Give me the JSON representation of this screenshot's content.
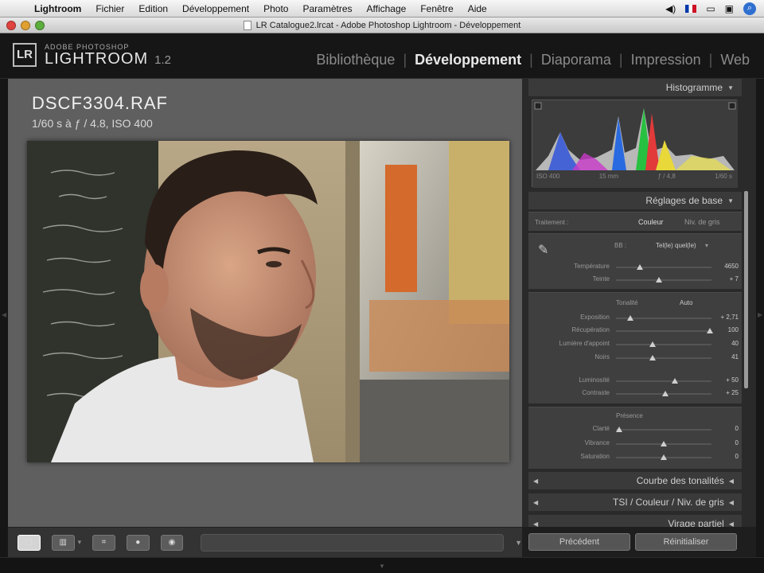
{
  "menubar": {
    "app_name": "Lightroom",
    "items": [
      "Fichier",
      "Edition",
      "Développement",
      "Photo",
      "Paramètres",
      "Affichage",
      "Fenêtre",
      "Aide"
    ]
  },
  "window": {
    "title": "LR Catalogue2.lrcat - Adobe Photoshop Lightroom - Développement"
  },
  "logo": {
    "line1": "ADOBE PHOTOSHOP",
    "line2": "LIGHTROOM",
    "version": "1.2",
    "badge": "LR"
  },
  "modules": [
    {
      "label": "Bibliothèque",
      "active": false
    },
    {
      "label": "Développement",
      "active": true
    },
    {
      "label": "Diaporama",
      "active": false
    },
    {
      "label": "Impression",
      "active": false
    },
    {
      "label": "Web",
      "active": false
    }
  ],
  "photo": {
    "filename": "DSCF3304.RAF",
    "exposure_info": "1/60 s à ƒ / 4.8, ISO 400"
  },
  "histogram": {
    "header": "Histogramme",
    "info": [
      "ISO 400",
      "15 mm",
      "ƒ / 4,8",
      "1/60 s"
    ]
  },
  "basic": {
    "header": "Réglages de base",
    "treatment_label": "Traitement :",
    "treatment_color": "Couleur",
    "treatment_gray": "Niv. de gris",
    "wb_label": "BB :",
    "wb_value": "Tel(le) quel(le)",
    "tone_title": "Tonalité",
    "tone_auto": "Auto",
    "presence_title": "Présence",
    "sliders": [
      {
        "label": "Température",
        "value": "4650",
        "level": 0.25
      },
      {
        "label": "Teinte",
        "value": "+ 7",
        "level": 0.45
      },
      {
        "label": "Exposition",
        "value": "+ 2,71",
        "level": 0.15
      },
      {
        "label": "Récupération",
        "value": "100",
        "level": 0.98
      },
      {
        "label": "Lumière d'appoint",
        "value": "40",
        "level": 0.38
      },
      {
        "label": "Noirs",
        "value": "41",
        "level": 0.38
      },
      {
        "label": "Luminosité",
        "value": "+ 50",
        "level": 0.62
      },
      {
        "label": "Contraste",
        "value": "+ 25",
        "level": 0.52
      },
      {
        "label": "Clarté",
        "value": "0",
        "level": 0.03
      },
      {
        "label": "Vibrance",
        "value": "0",
        "level": 0.5
      },
      {
        "label": "Saturation",
        "value": "0",
        "level": 0.5
      }
    ]
  },
  "collapsed_sections": [
    {
      "label": "Courbe des tonalités"
    },
    {
      "label": "TSI / Couleur / Niv. de gris"
    },
    {
      "label": "Virage partiel"
    }
  ],
  "buttons": {
    "previous": "Précédent",
    "reset": "Réinitialiser"
  }
}
